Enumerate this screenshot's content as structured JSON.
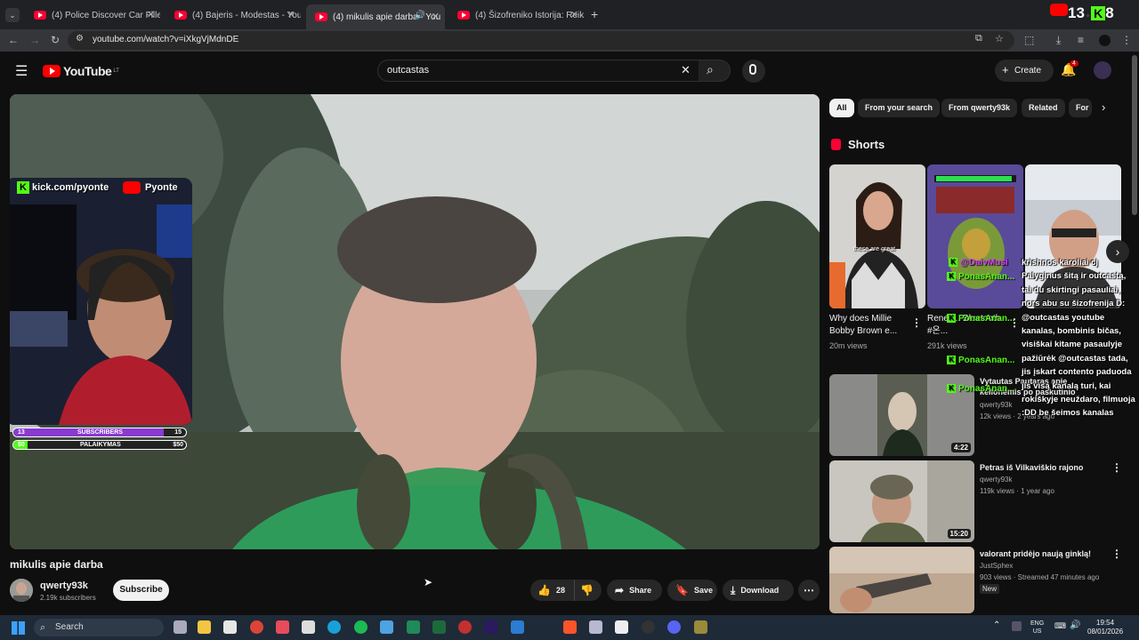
{
  "browser": {
    "tabs": [
      {
        "title": "(4) Police Discover Car Filled W"
      },
      {
        "title": "(4) Bajeris - Modestas - YouTub"
      },
      {
        "title": "(4) mikulis apie darba - You",
        "active": true
      },
      {
        "title": "(4) Šizofreniko Istorija: Reikalai"
      }
    ],
    "url": "youtube.com/watch?v=iXkgVjMdnDE"
  },
  "stream_overlay": {
    "kick_count": "13",
    "kick_count2": "8",
    "kick_handle": "kick.com/pyonte",
    "yt_handle": "Pyonte",
    "subscribers_label": "SUBSCRIBERS",
    "subscribers_left": "13",
    "subscribers_right": "15",
    "subscribers_progress": 0.87,
    "support_label": "PALAIKYMAS",
    "support_left": "$0",
    "support_right": "$50",
    "support_progress": 0.05
  },
  "youtube": {
    "logo_text": "YouTube",
    "country": "LT",
    "search_value": "outcastas",
    "create_label": "Create",
    "notif_count": "4"
  },
  "video": {
    "title": "mikulis apie darba",
    "channel": "qwerty93k",
    "subscribers": "2.19k subscribers",
    "subscribe_label": "Subscribe",
    "likes": "28",
    "share_label": "Share",
    "save_label": "Save",
    "download_label": "Download"
  },
  "sidebar": {
    "chips": [
      "All",
      "From your search",
      "From qwerty93k",
      "Related",
      "For"
    ],
    "shorts_heading": "Shorts",
    "shorts": [
      {
        "title": "Why does Millie Bobby Brown e...",
        "views": "20m views",
        "caption": "these are great"
      },
      {
        "title": "Renek... Bluetooth #온...",
        "views": "291k views"
      },
      {
        "title": "",
        "views": ""
      }
    ],
    "videos": [
      {
        "title": "Vytautas Pautaras apie kelionėmis po paskutinio",
        "channel": "qwerty93k",
        "meta": "12k views · 2 years ago",
        "duration": "4:22"
      },
      {
        "title": "Petras iš Vilkaviškio rajono",
        "channel": "qwerty93k",
        "meta": "119k views · 1 year ago",
        "duration": "15:20"
      },
      {
        "title": "valorant pridėjo naują ginklą!",
        "channel": "JustSphex",
        "meta": "903 views · Streamed 47 minutes ago",
        "badge": "New"
      }
    ]
  },
  "chat": {
    "handles": [
      "@DaivMusi",
      "PonasAnan...",
      "PonasAnan...",
      "PonasAnan...",
      "PonasAnan..."
    ],
    "message": "krishnos karoliai cj Palyginus šitą ir outcastą, tai du skirtingi pasauliai, nors abu su šizofrenija D: @outcastas youtube kanalas, bombinis bičas, visiškai kitame pasaulyje pažiūrėk @outcastas tada, jis įskart contento paduoda jis visą kanalą turi, kai rokiškyje neuždaro, filmuoja :DD be šeimos kanalas"
  },
  "taskbar": {
    "search_placeholder": "Search",
    "lang": "ENG",
    "region": "US",
    "time": "19:54",
    "date": "08/01/2026"
  }
}
